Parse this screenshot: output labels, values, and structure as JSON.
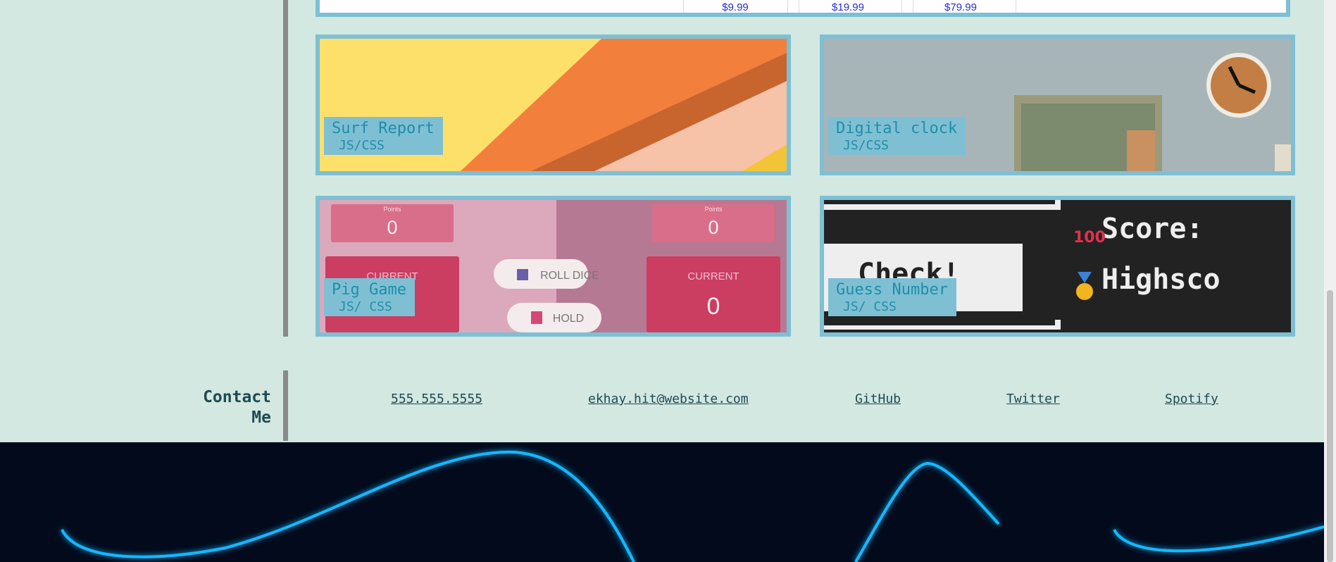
{
  "pricing": {
    "prices": [
      "$9.99",
      "$19.99",
      "$79.99"
    ]
  },
  "projects": [
    {
      "title": "Surf Report",
      "tech": "JS/CSS"
    },
    {
      "title": "Digital clock",
      "tech": "JS/CSS"
    },
    {
      "title": "Pig Game",
      "tech": "JS/ CSS",
      "preview": {
        "points_label": "Points",
        "score_left": "0",
        "score_right": "0",
        "current_label": "CURRENT",
        "current_value": "0",
        "roll_label": "ROLL DICE",
        "hold_label": "HOLD"
      }
    },
    {
      "title": "Guess Number",
      "tech": "JS/ CSS",
      "preview": {
        "check_label": "Check!",
        "score_label": "Score:",
        "highscore_label": "Highsco"
      }
    }
  ],
  "contact": {
    "label": "Contact Me",
    "phone": "555.555.5555",
    "email": "ekhay.hit@website.com",
    "github": "GitHub",
    "twitter": "Twitter",
    "spotify": "Spotify"
  },
  "colors": {
    "background": "#d2e8e0",
    "card_border": "#7fbfd4",
    "caption_text": "#1f8ea8",
    "link_text": "#1f4a52",
    "price_text": "#2a2ad8",
    "footer_bg": "#020a1c",
    "neon": "#18b8ff"
  }
}
